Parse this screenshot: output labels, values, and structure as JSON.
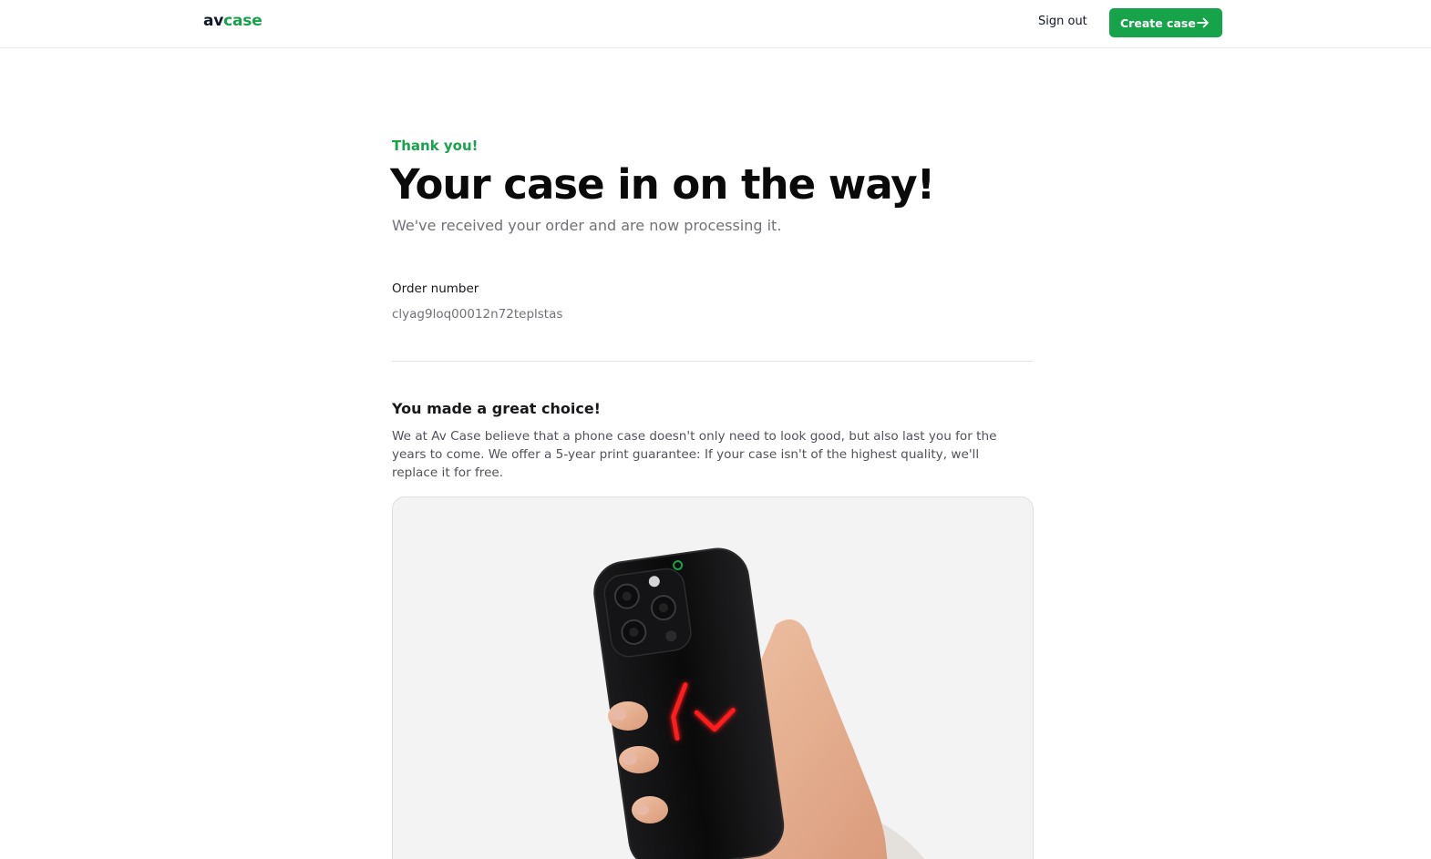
{
  "header": {
    "logo_prefix": "av",
    "logo_accent": "case",
    "sign_out_label": "Sign out",
    "create_case_label": "Create case"
  },
  "confirmation": {
    "eyebrow": "Thank you!",
    "title": "Your case in on the way!",
    "subtitle": "We've received your order and are now processing it."
  },
  "order": {
    "label": "Order number",
    "value": "clyag9loq00012n72teplstas"
  },
  "choice": {
    "title": "You made a great choice!",
    "text": "We at Av Case believe that a phone case doesn't only need to look good, but also last you for the years to come. We offer a 5-year print guarantee: If your case isn't of the highest quality, we'll replace it for free."
  },
  "colors": {
    "brand_green": "#16a34a",
    "preview_bg": "#f3f3f3",
    "case_color": "#0b0b0c",
    "logo_glow": "#ff1a1a"
  },
  "preview": {
    "image": "hand-holding-phone-case",
    "case_print": "red-glowing-av-logo"
  }
}
